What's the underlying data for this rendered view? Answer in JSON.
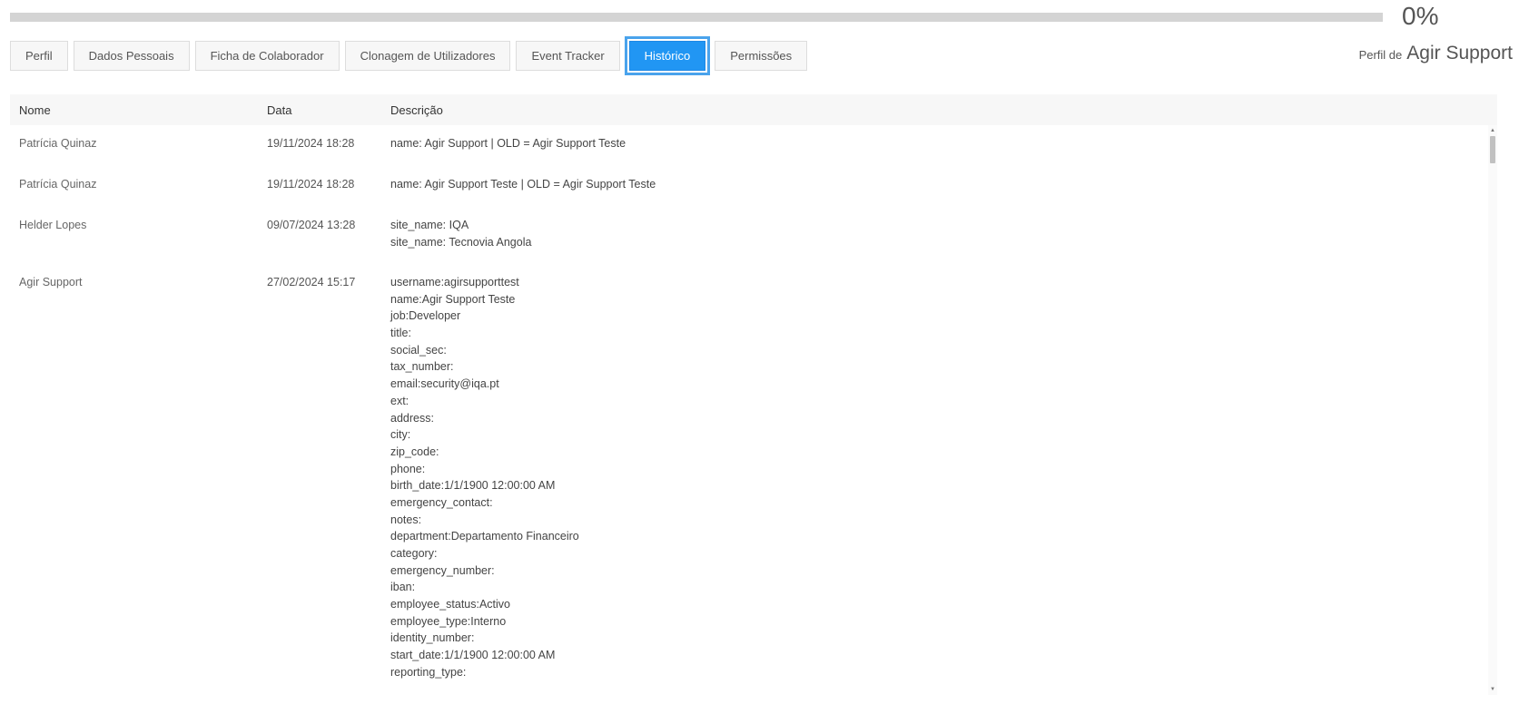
{
  "progress": {
    "percent_value": 0,
    "label": "0%",
    "fill_color": "#337ab7",
    "track_color": "#d4d4d4"
  },
  "tabs": [
    {
      "label": "Perfil",
      "active": false
    },
    {
      "label": "Dados Pessoais",
      "active": false
    },
    {
      "label": "Ficha de Colaborador",
      "active": false
    },
    {
      "label": "Clonagem de Utilizadores",
      "active": false
    },
    {
      "label": "Event Tracker",
      "active": false
    },
    {
      "label": "Histórico",
      "active": true
    },
    {
      "label": "Permissões",
      "active": false
    }
  ],
  "profile": {
    "prefix": "Perfil de",
    "name": "Agir Support"
  },
  "table": {
    "headers": {
      "nome": "Nome",
      "data": "Data",
      "descricao": "Descrição"
    },
    "rows": [
      {
        "nome": "Patrícia Quinaz",
        "data": "19/11/2024 18:28",
        "descricao": [
          "name: Agir Support | OLD = Agir Support Teste"
        ]
      },
      {
        "nome": "Patrícia Quinaz",
        "data": "19/11/2024 18:28",
        "descricao": [
          "name: Agir Support Teste | OLD = Agir Support Teste"
        ]
      },
      {
        "nome": "Helder Lopes",
        "data": "09/07/2024 13:28",
        "descricao": [
          "site_name: IQA",
          "site_name: Tecnovia Angola"
        ]
      },
      {
        "nome": "Agir Support",
        "data": "27/02/2024 15:17",
        "descricao": [
          "username:agirsupporttest",
          "name:Agir Support Teste",
          "job:Developer",
          "title:",
          "social_sec:",
          "tax_number:",
          "email:security@iqa.pt",
          "ext:",
          "address:",
          "city:",
          "zip_code:",
          "phone:",
          "birth_date:1/1/1900 12:00:00 AM",
          "emergency_contact:",
          "notes:",
          "department:Departamento Financeiro",
          "category:",
          "emergency_number:",
          "iban:",
          "employee_status:Activo",
          "employee_type:Interno",
          "identity_number:",
          "start_date:1/1/1900 12:00:00 AM",
          "reporting_type:"
        ]
      }
    ]
  },
  "colors": {
    "active_tab": "#2196f3",
    "active_tab_outline": "#4aa3ec",
    "header_bg": "#f7f7f7"
  }
}
